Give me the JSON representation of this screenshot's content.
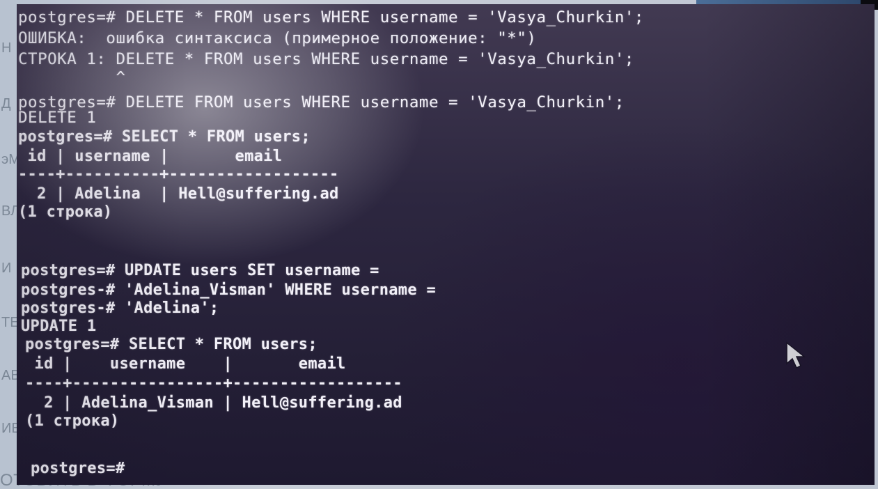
{
  "background_doc": {
    "fragments": [
      "Н",
      "Д",
      "эМ",
      "ВЛ",
      "И",
      "ТЕ",
      "АВ",
      "ИЕ"
    ],
    "bottom_text": "ОТОВИТЬ В ФОРМУ"
  },
  "terminal": {
    "lines": [
      "postgres=# DELETE * FROM users WHERE username = 'Vasya_Churkin';",
      "ОШИБКА:  ошибка синтаксиса (примерное положение: \"*\")",
      "СТРОКА 1: DELETE * FROM users WHERE username = 'Vasya_Churkin';",
      "          ^",
      "postgres=# DELETE FROM users WHERE username = 'Vasya_Churkin';",
      "DELETE 1",
      "postgres=# SELECT * FROM users;",
      " id | username |       email",
      "----+----------+------------------",
      "  2 | Adelina  | Hell@suffering.ad",
      "(1 строка)",
      "postgres=# UPDATE users SET username =",
      "postgres-# 'Adelina_Visman' WHERE username =",
      "postgres-# 'Adelina';",
      "UPDATE 1",
      "postgres=# SELECT * FROM users;",
      " id |    username    |       email",
      "----+----------------+------------------",
      "  2 | Adelina_Visman | Hell@suffering.ad",
      "(1 строка)",
      "postgres=#"
    ]
  },
  "pointer": {
    "icon": "mouse-pointer-icon"
  }
}
